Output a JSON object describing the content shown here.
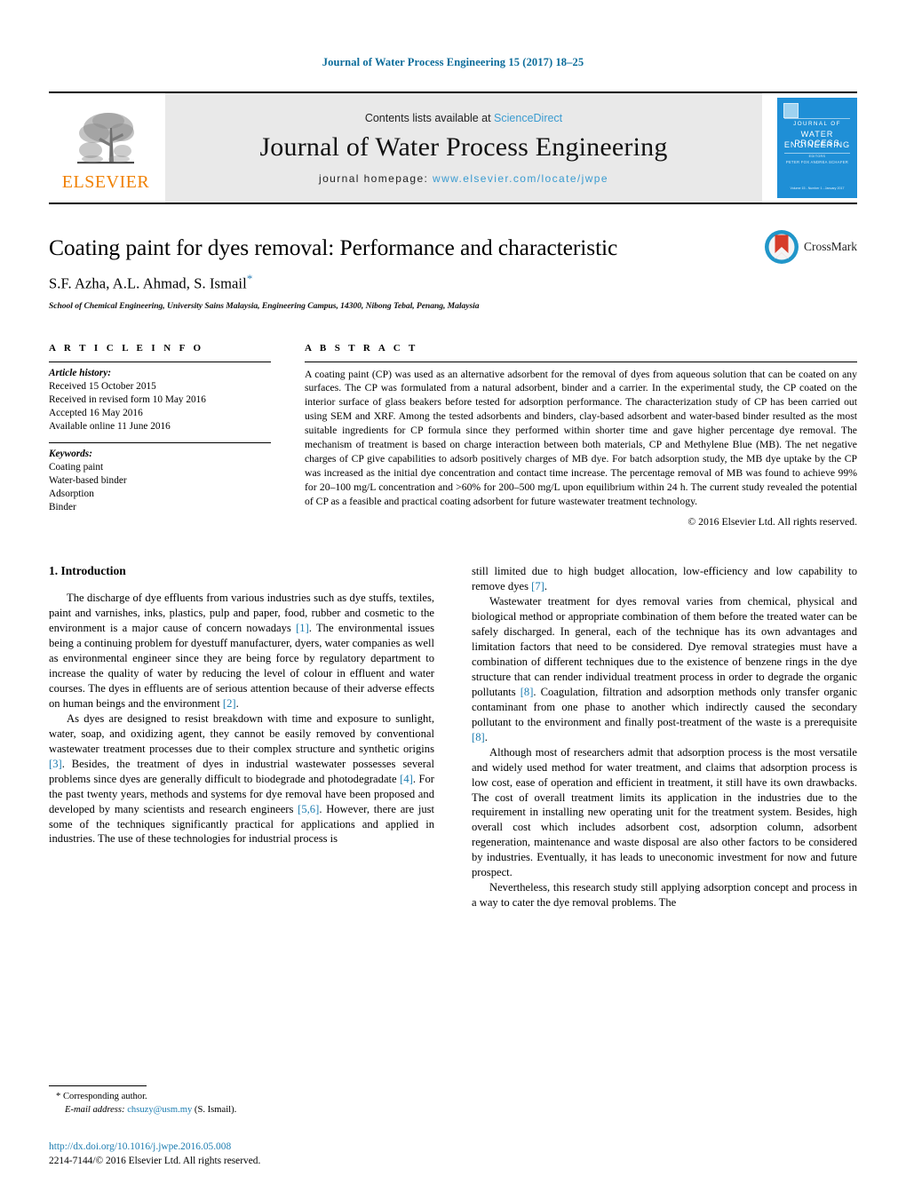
{
  "running_head": "Journal of Water Process Engineering 15 (2017) 18–25",
  "masthead": {
    "publisher_name": "ELSEVIER",
    "contents_prefix": "Contents lists available at ",
    "contents_link": "ScienceDirect",
    "journal_name": "Journal of Water Process Engineering",
    "homepage_prefix": "journal homepage: ",
    "homepage_url": "www.elsevier.com/locate/jwpe",
    "cover": {
      "line1": "JOURNAL OF",
      "line2": "WATER PROCESS",
      "line3": "ENGINEERING",
      "sub1": "EDITORS",
      "sub2": "PETER FOX  ANDREA SCHAFER",
      "footer": "Volume 15 - Number 1 - January 2017"
    },
    "accent_blue": "#3a9bd0",
    "orange": "#f08000",
    "cover_blue": "#1f8fd6"
  },
  "article": {
    "title": "Coating paint for dyes removal: Performance and characteristic",
    "authors": "S.F. Azha, A.L. Ahmad, S. Ismail",
    "corresponding_mark": "*",
    "affiliation": "School of Chemical Engineering, University Sains Malaysia, Engineering Campus, 14300, Nibong Tebal, Penang, Malaysia",
    "crossmark_label": "CrossMark"
  },
  "info": {
    "heading": "A R T I C L E   I N F O",
    "history_label": "Article history:",
    "history": [
      "Received 15 October 2015",
      "Received in revised form 10 May 2016",
      "Accepted 16 May 2016",
      "Available online 11 June 2016"
    ],
    "keywords_label": "Keywords:",
    "keywords": [
      "Coating paint",
      "Water-based binder",
      "Adsorption",
      "Binder"
    ]
  },
  "abstract": {
    "heading": "A B S T R A C T",
    "text": "A coating paint (CP) was used as an alternative adsorbent for the removal of dyes from aqueous solution that can be coated on any surfaces. The CP was formulated from a natural adsorbent, binder and a carrier. In the experimental study, the CP coated on the interior surface of glass beakers before tested for adsorption performance. The characterization study of CP has been carried out using SEM and XRF. Among the tested adsorbents and binders, clay-based adsorbent and water-based binder resulted as the most suitable ingredients for CP formula since they performed within shorter time and gave higher percentage dye removal. The mechanism of treatment is based on charge interaction between both materials, CP and Methylene Blue (MB). The net negative charges of CP give capabilities to adsorb positively charges of MB dye. For batch adsorption study, the MB dye uptake by the CP was increased as the initial dye concentration and contact time increase. The percentage removal of MB was found to achieve 99% for 20–100 mg/L concentration and >60% for 200–500 mg/L upon equilibrium within 24 h. The current study revealed the potential of CP as a feasible and practical coating adsorbent for future wastewater treatment technology.",
    "copyright": "© 2016 Elsevier Ltd. All rights reserved."
  },
  "body": {
    "section_title": "1. Introduction",
    "left_paragraphs": [
      {
        "parts": [
          {
            "t": "The discharge of dye effluents from various industries such as dye stuffs, textiles, paint and varnishes, inks, plastics, pulp and paper, food, rubber and cosmetic to the environment is a major cause of concern nowadays "
          },
          {
            "t": "[1]",
            "ref": true
          },
          {
            "t": ". The environmental issues being a continuing problem for dyestuff manufacturer, dyers, water companies as well as environmental engineer since they are being force by regulatory department to increase the quality of water by reducing the level of colour in effluent and water courses. The dyes in effluents are of serious attention because of their adverse effects on human beings and the environment "
          },
          {
            "t": "[2]",
            "ref": true
          },
          {
            "t": "."
          }
        ]
      },
      {
        "parts": [
          {
            "t": "As dyes are designed to resist breakdown with time and exposure to sunlight, water, soap, and oxidizing agent, they cannot be easily removed by conventional wastewater treatment processes due to their complex structure and synthetic origins "
          },
          {
            "t": "[3]",
            "ref": true
          },
          {
            "t": ". Besides, the treatment of dyes in industrial wastewater possesses several problems since dyes are generally difficult to biodegrade and photodegradate "
          },
          {
            "t": "[4]",
            "ref": true
          },
          {
            "t": ". For the past twenty years, methods and systems for dye removal have been proposed and developed by many scientists and research engineers "
          },
          {
            "t": "[5,6]",
            "ref": true
          },
          {
            "t": ". However, there are just some of the techniques significantly practical for applications and applied in industries. The use of these technologies for industrial process is"
          }
        ]
      }
    ],
    "right_paragraphs": [
      {
        "continued": true,
        "parts": [
          {
            "t": "still limited due to high budget allocation, low-efficiency and low capability to remove dyes "
          },
          {
            "t": "[7]",
            "ref": true
          },
          {
            "t": "."
          }
        ]
      },
      {
        "parts": [
          {
            "t": "Wastewater treatment for dyes removal varies from chemical, physical and biological method or appropriate combination of them before the treated water can be safely discharged. In general, each of the technique has its own advantages and limitation factors that need to be considered. Dye removal strategies must have a combination of different techniques due to the existence of benzene rings in the dye structure that can render individual treatment process in order to degrade the organic pollutants "
          },
          {
            "t": "[8]",
            "ref": true
          },
          {
            "t": ". Coagulation, filtration and adsorption methods only transfer organic contaminant from one phase to another which indirectly caused the secondary pollutant to the environment and finally post-treatment of the waste is a prerequisite "
          },
          {
            "t": "[8]",
            "ref": true
          },
          {
            "t": "."
          }
        ]
      },
      {
        "parts": [
          {
            "t": "Although most of researchers admit that adsorption process is the most versatile and widely used method for water treatment, and claims that adsorption process is low cost, ease of operation and efficient in treatment, it still have its own drawbacks. The cost of overall treatment limits its application in the industries due to the requirement in installing new operating unit for the treatment system. Besides, high overall cost which includes adsorbent cost, adsorption column, adsorbent regeneration, maintenance and waste disposal are also other factors to be considered by industries. Eventually, it has leads to uneconomic investment for now and future prospect."
          }
        ]
      },
      {
        "parts": [
          {
            "t": "Nevertheless, this research study still applying adsorption concept and process in a way to cater the dye removal problems. The"
          }
        ]
      }
    ]
  },
  "footer": {
    "corresponding_mark": "*",
    "corresponding_label": "Corresponding author.",
    "email_label": "E-mail address:",
    "email": "chsuzy@usm.my",
    "email_owner": "(S. Ismail).",
    "doi": "http://dx.doi.org/10.1016/j.jwpe.2016.05.008",
    "issn_line": "2214-7144/© 2016 Elsevier Ltd. All rights reserved."
  }
}
